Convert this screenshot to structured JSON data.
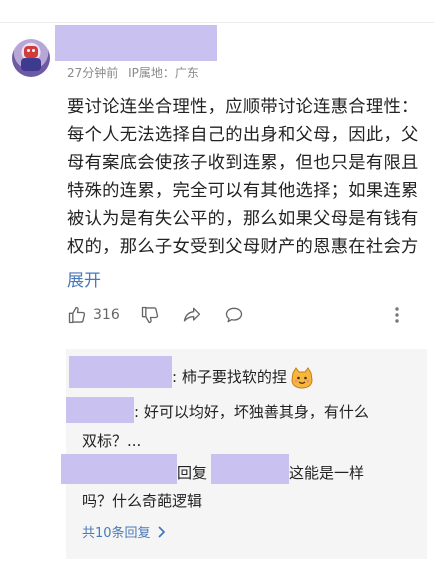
{
  "comment": {
    "time": "27分钟前",
    "location": "IP属地：广东",
    "text": "要讨论连坐合理性，应顺带讨论连惠合理性：每个人无法选择自己的出身和父母，因此，父母有案底会使孩子收到连累，但也只是有限且特殊的连累，完全可以有其他选择；如果连累被认为是有失公平的，那么如果父母是有钱有权的，那么子女受到父母财产的恩惠在社会方",
    "expand_label": "展开",
    "like_count": "316"
  },
  "replies": [
    {
      "text": ": 柿子要找软的捏"
    },
    {
      "text": ": 好可以均好，坏独善其身，有什么",
      "text2": "双标？..."
    },
    {
      "reply_word": "回复",
      "text": "这能是一样",
      "text2": "吗？什么奇葩逻辑"
    }
  ],
  "more_replies_label": "共10条回复"
}
